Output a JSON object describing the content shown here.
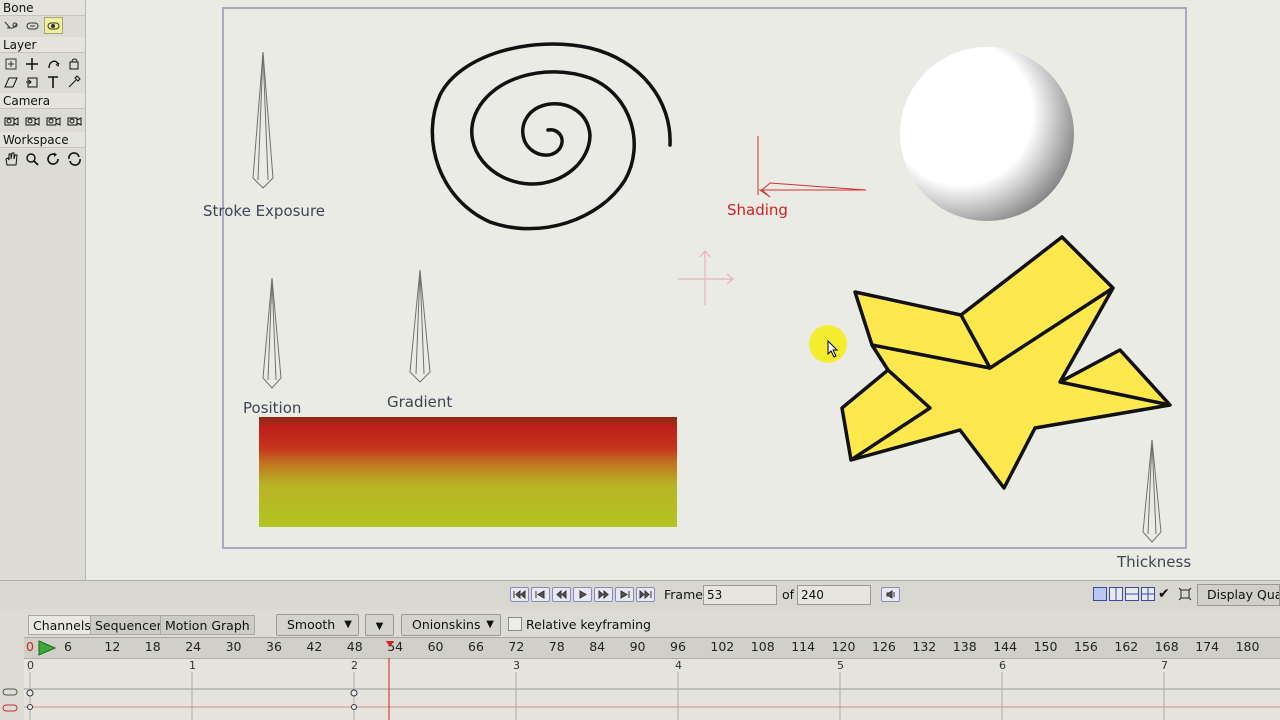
{
  "tool_panel": {
    "groups": [
      {
        "title": "Bone"
      },
      {
        "title": "Layer"
      },
      {
        "title": "Camera"
      },
      {
        "title": "Workspace"
      }
    ]
  },
  "canvas": {
    "labels": {
      "stroke_exposure": "Stroke Exposure",
      "shading": "Shading",
      "position": "Position",
      "gradient": "Gradient",
      "thickness": "Thickness"
    },
    "colors": {
      "star_fill": "#fde84e",
      "shading_label": "#d02020",
      "cursor_highlight": "#f5ec1a"
    }
  },
  "transport": {
    "frame_label": "Frame",
    "frame_value": "53",
    "of_label": "of",
    "total_frames": "240",
    "display_quality": "Display Quali"
  },
  "timeline": {
    "tabs": [
      "Channels",
      "Sequencer",
      "Motion Graph"
    ],
    "interpolation": "Smooth",
    "onionskins": "Onionskins",
    "relative_keyframing": "Relative keyframing",
    "ruler_start": "0",
    "ruler_ticks": [
      "6",
      "12",
      "18",
      "24",
      "30",
      "36",
      "42",
      "48",
      "54",
      "60",
      "66",
      "72",
      "78",
      "84",
      "90",
      "96",
      "102",
      "108",
      "114",
      "120",
      "126",
      "132",
      "138",
      "144",
      "150",
      "156",
      "162",
      "168",
      "174",
      "180"
    ],
    "current_frame": 53,
    "track_markers": [
      "0",
      "1",
      "2",
      "3",
      "4",
      "5",
      "6",
      "7"
    ]
  }
}
